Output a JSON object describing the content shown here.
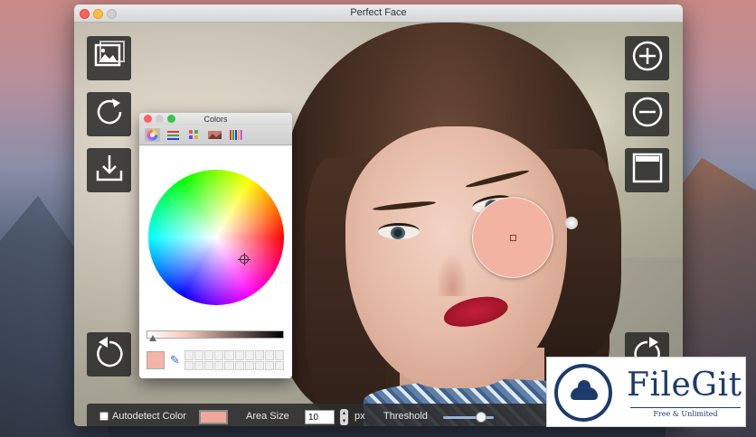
{
  "window": {
    "title": "Perfect Face"
  },
  "colors_panel": {
    "title": "Colors",
    "tabs": [
      "color-wheel",
      "color-sliders",
      "color-palettes",
      "image-palettes",
      "pencils"
    ],
    "selected_color": "#F4B5A7"
  },
  "bottom_bar": {
    "autodetect_label": "Autodetect Color",
    "autodetect_checked": false,
    "selected_color": "#F0A89A",
    "area_size_label": "Area Size",
    "area_size_value": "10",
    "area_size_unit": "px",
    "threshold_label": "Threshold",
    "threshold_fraction": 0.75
  },
  "tools": {
    "left": [
      "open-image-icon",
      "rotate-icon",
      "save-download-icon",
      "undo-icon"
    ],
    "right": [
      "zoom-in-icon",
      "zoom-out-icon",
      "fit-view-icon",
      "redo-icon"
    ]
  },
  "watermark": {
    "brand": "FileGit",
    "tagline": "Free & Unlimited"
  },
  "colors": {
    "accent": "#2C6BD6",
    "skin_sample": "#F2B3A3"
  }
}
